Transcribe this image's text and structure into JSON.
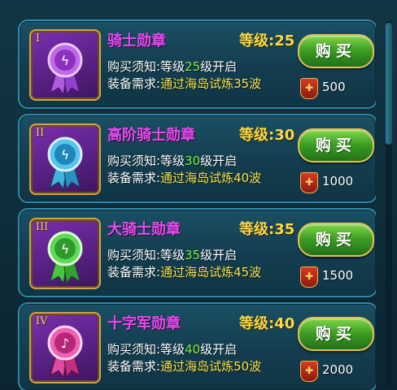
{
  "colors": {
    "name": "#e54cf0",
    "level": "#f7d94a",
    "required_level": "#7ef03a",
    "required_task": "#f7e24a"
  },
  "items": [
    {
      "roman": "I",
      "name": "骑士勋章",
      "level_text": "等级:25",
      "buy_prefix": "购买须知:等级",
      "buy_level": "25",
      "buy_suffix": "级开启",
      "req_prefix": "装备需求:",
      "req_task": "通过海岛试炼35波",
      "buy_label": "购买",
      "price": "500",
      "medal_color": "#9b3fd6",
      "medal_icon": "purple-medal-icon"
    },
    {
      "roman": "II",
      "name": "高阶骑士勋章",
      "level_text": "等级:30",
      "buy_prefix": "购买须知:等级",
      "buy_level": "30",
      "buy_suffix": "级开启",
      "req_prefix": "装备需求:",
      "req_task": "通过海岛试炼40波",
      "buy_label": "购买",
      "price": "1000",
      "medal_color": "#2ea8d8",
      "medal_icon": "blue-medal-icon"
    },
    {
      "roman": "III",
      "name": "大骑士勋章",
      "level_text": "等级:35",
      "buy_prefix": "购买须知:等级",
      "buy_level": "35",
      "buy_suffix": "级开启",
      "req_prefix": "装备需求:",
      "req_task": "通过海岛试炼45波",
      "buy_label": "购买",
      "price": "1500",
      "medal_color": "#3fbf3a",
      "medal_icon": "green-medal-icon"
    },
    {
      "roman": "IV",
      "name": "十字军勋章",
      "level_text": "等级:40",
      "buy_prefix": "购买须知:等级",
      "buy_level": "40",
      "buy_suffix": "级开启",
      "req_prefix": "装备需求:",
      "req_task": "通过海岛试炼50波",
      "buy_label": "购买",
      "price": "2000",
      "medal_color": "#e0399a",
      "medal_icon": "pink-medal-icon"
    }
  ]
}
